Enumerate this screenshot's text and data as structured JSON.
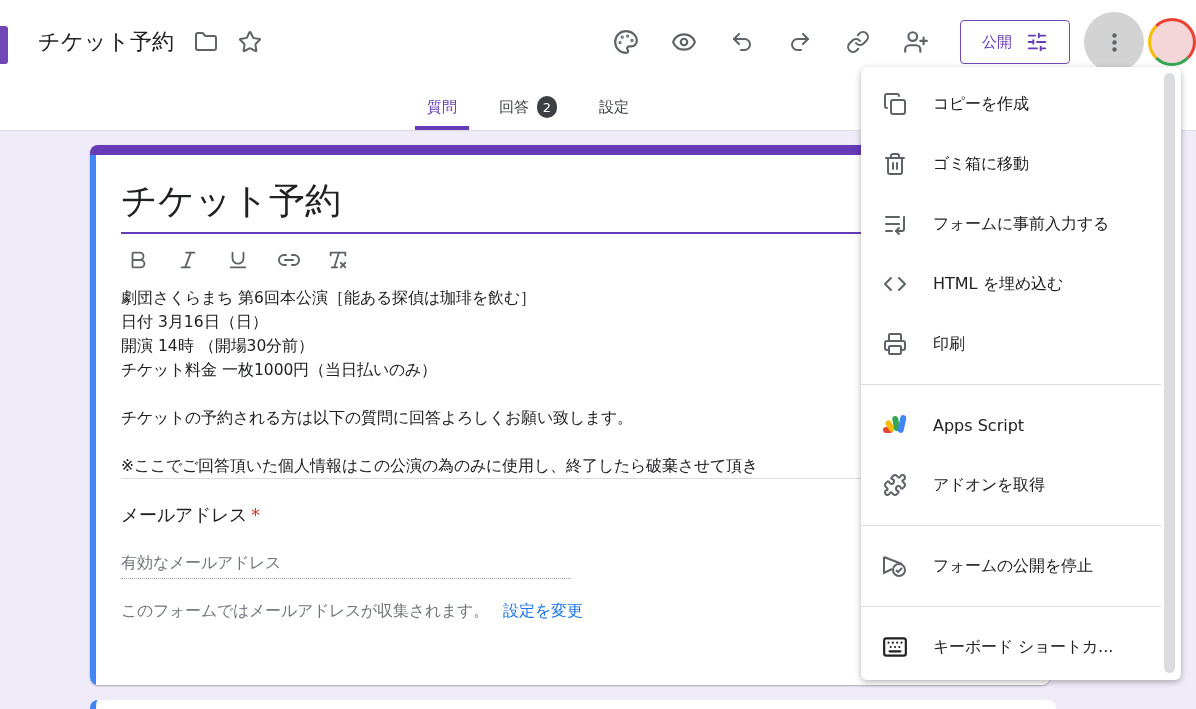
{
  "header": {
    "title": "チケット予約",
    "publish_button": "公開"
  },
  "tabs": [
    {
      "label": "質問",
      "selected": true
    },
    {
      "label": "回答",
      "selected": false,
      "badge": "2"
    },
    {
      "label": "設定",
      "selected": false
    }
  ],
  "form": {
    "title": "チケット予約",
    "description": [
      [
        "劇団さくらまち 第6回本公演［能ある探偵は珈琲を飲む］",
        "日付 3月16日（日）",
        "開演 14時 （開場30分前）",
        "チケット料金 一枚1000円（当日払いのみ）"
      ],
      [
        "チケットの予約される方は以下の質問に回答よろしくお願い致します。"
      ],
      [
        "※ここでご回答頂いた個人情報はこの公演の為のみに使用し、終了したら破棄させて頂き"
      ]
    ],
    "question": {
      "label": "メールアドレス",
      "required": true,
      "required_mark": "*",
      "placeholder": "有効なメールアドレス",
      "note": "このフォームではメールアドレスが収集されます。",
      "link": "設定を変更"
    }
  },
  "menu": [
    {
      "kind": "copy",
      "label": "コピーを作成"
    },
    {
      "kind": "trash",
      "label": "ゴミ箱に移動"
    },
    {
      "kind": "prefill",
      "label": "フォームに事前入力する"
    },
    {
      "kind": "embed",
      "label": "HTML を埋め込む"
    },
    {
      "kind": "print",
      "label": "印刷",
      "divider_after": true
    },
    {
      "kind": "script",
      "label": "Apps Script"
    },
    {
      "kind": "addon",
      "label": "アドオンを取得",
      "divider_after": true
    },
    {
      "kind": "unpublish",
      "label": "フォームの公開を停止",
      "divider_after": true
    },
    {
      "kind": "keyboard",
      "label": "キーボード ショートカ..."
    }
  ]
}
